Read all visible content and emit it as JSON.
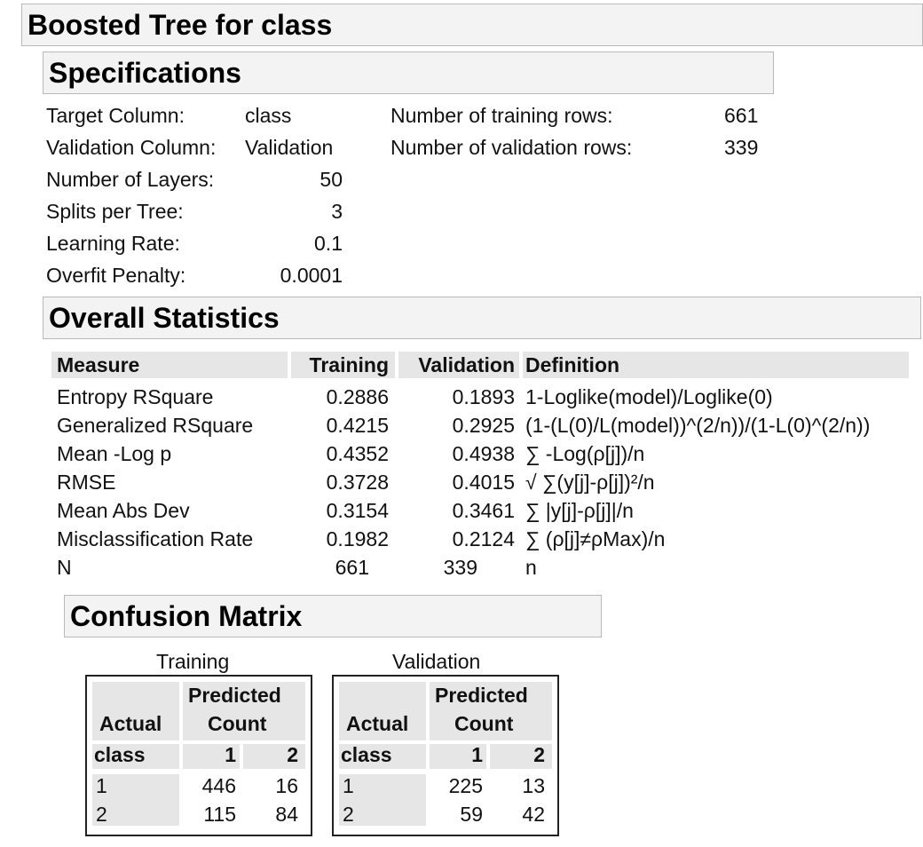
{
  "report": {
    "title": "Boosted Tree for class"
  },
  "specifications": {
    "title": "Specifications",
    "left": [
      {
        "label": "Target Column:",
        "value": "class"
      },
      {
        "label": "Validation Column:",
        "value": "Validation"
      },
      {
        "label": "Number of Layers:",
        "value": "50"
      },
      {
        "label": "Splits per Tree:",
        "value": "3"
      },
      {
        "label": "Learning Rate:",
        "value": "0.1"
      },
      {
        "label": "Overfit Penalty:",
        "value": "0.0001"
      }
    ],
    "right": [
      {
        "label": "Number of training rows:",
        "value": "661"
      },
      {
        "label": "Number of validation rows:",
        "value": "339"
      }
    ]
  },
  "overall_statistics": {
    "title": "Overall Statistics",
    "headers": [
      "Measure",
      "Training",
      "Validation",
      "Definition"
    ],
    "rows": [
      {
        "measure": "Entropy RSquare",
        "training": "0.2886",
        "validation": "0.1893",
        "definition": "1-Loglike(model)/Loglike(0)"
      },
      {
        "measure": "Generalized RSquare",
        "training": "0.4215",
        "validation": "0.2925",
        "definition": "(1-(L(0)/L(model))^(2/n))/(1-L(0)^(2/n))"
      },
      {
        "measure": "Mean -Log p",
        "training": "0.4352",
        "validation": "0.4938",
        "definition": "∑ -Log(ρ[j])/n"
      },
      {
        "measure": "RMSE",
        "training": "0.3728",
        "validation": "0.4015",
        "definition": "√ ∑(y[j]-ρ[j])²/n"
      },
      {
        "measure": "Mean Abs Dev",
        "training": "0.3154",
        "validation": "0.3461",
        "definition": "∑ |y[j]-ρ[j]|/n"
      },
      {
        "measure": "Misclassification Rate",
        "training": "0.1982",
        "validation": "0.2124",
        "definition": "∑ (ρ[j]≠ρMax)/n"
      },
      {
        "measure": "N",
        "training": "661",
        "validation": "339",
        "definition": "n"
      }
    ]
  },
  "confusion_matrix": {
    "title": "Confusion Matrix",
    "tables": [
      {
        "title": "Training",
        "predicted_label_1": "Predicted",
        "predicted_label_2": "Count",
        "actual_label": "Actual",
        "class_label": "class",
        "col_1": "1",
        "col_2": "2",
        "rows": [
          {
            "cls": "1",
            "c1": "446",
            "c2": "16"
          },
          {
            "cls": "2",
            "c1": "115",
            "c2": "84"
          }
        ]
      },
      {
        "title": "Validation",
        "predicted_label_1": "Predicted",
        "predicted_label_2": "Count",
        "actual_label": "Actual",
        "class_label": "class",
        "col_1": "1",
        "col_2": "2",
        "rows": [
          {
            "cls": "1",
            "c1": "225",
            "c2": "13"
          },
          {
            "cls": "2",
            "c1": "59",
            "c2": "42"
          }
        ]
      }
    ]
  }
}
